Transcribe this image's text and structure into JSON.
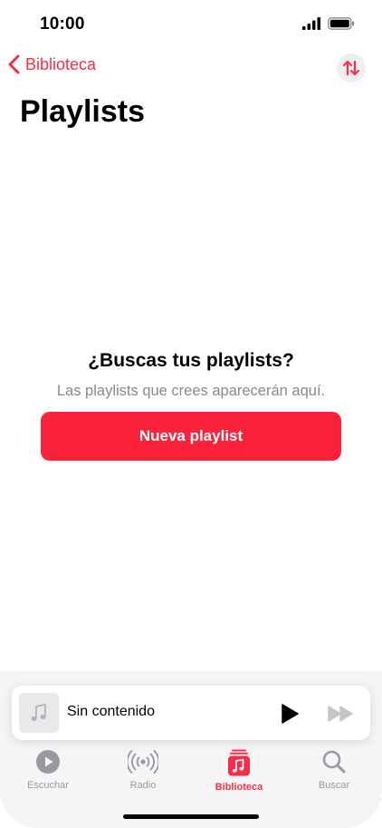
{
  "status_bar": {
    "time": "10:00"
  },
  "nav": {
    "back_label": "Biblioteca",
    "sort_icon": "arrow-up-down-icon"
  },
  "page": {
    "title": "Playlists"
  },
  "empty_state": {
    "title": "¿Buscas tus playlists?",
    "subtitle": "Las playlists que crees aparecerán aquí.",
    "button_label": "Nueva playlist"
  },
  "mini_player": {
    "track_title": "Sin contenido",
    "artwork_icon": "music-note-icon"
  },
  "tabs": [
    {
      "label": "Escuchar",
      "icon": "play-circle-icon",
      "active": false
    },
    {
      "label": "Radio",
      "icon": "radio-waves-icon",
      "active": false
    },
    {
      "label": "Biblioteca",
      "icon": "library-icon",
      "active": true
    },
    {
      "label": "Buscar",
      "icon": "search-icon",
      "active": false
    }
  ],
  "colors": {
    "accent": "#fa2d48",
    "button": "#fa233b",
    "secondary_text": "#8a8a8e",
    "inactive_tab": "#9a9a9e"
  }
}
